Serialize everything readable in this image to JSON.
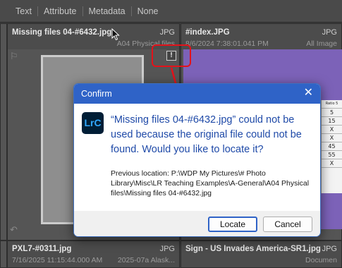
{
  "filterbar": {
    "items": [
      "Text",
      "Attribute",
      "Metadata",
      "None"
    ]
  },
  "cells": {
    "top_left": {
      "filename": "Missing files 04-#6432.jpg",
      "filetype": "JPG",
      "subtitle_right": "A04 Physical files"
    },
    "top_right": {
      "filename": "#index.JPG",
      "filetype": "JPG",
      "date": "8/6/2024 7:38:01.041 PM",
      "subtitle_right": "All Image"
    },
    "bottom_left": {
      "filename": "PXL7-#0311.jpg",
      "filetype": "JPG",
      "date": "7/16/2025 11:15:44.000 AM",
      "subtitle_right": "2025-07a Alask..."
    },
    "bottom_right": {
      "filename": "Sign - US Invades America-SR1.jpg",
      "filetype": "JPG",
      "subtitle_right": "Documen"
    }
  },
  "paper": {
    "header": "Ratio 5",
    "values": [
      "5",
      "15",
      "X",
      "X",
      "45",
      "55",
      "X"
    ]
  },
  "missing_badge": "!",
  "dialog": {
    "title": "Confirm",
    "close_glyph": "✕",
    "app_icon_label": "LrC",
    "message": "“Missing files 04-#6432.jpg” could not be used because the original file could not be found. Would you like to locate it?",
    "previous_location": "Previous location: P:\\WDP My Pictures\\# Photo Library\\Misc\\LR Teaching Examples\\A-General\\A04 Physical files\\Missing files 04-#6432.jpg",
    "locate_label": "Locate",
    "cancel_label": "Cancel"
  },
  "colors": {
    "accent": "#2f63c7",
    "annotation_red": "#e3121a",
    "message_blue": "#1f4aa8"
  }
}
